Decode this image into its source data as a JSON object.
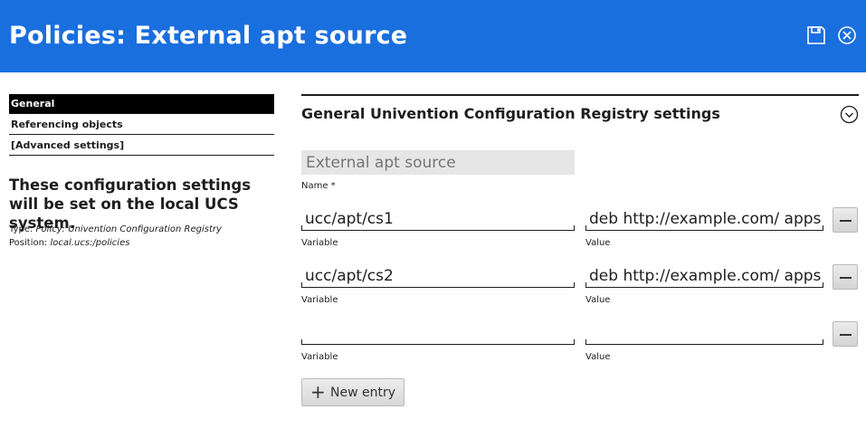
{
  "header": {
    "title": "Policies: External apt source",
    "save_icon": "save-icon",
    "close_icon": "close-icon",
    "background": "#1a6fde"
  },
  "sidebar": {
    "items": [
      {
        "label": "General",
        "active": true
      },
      {
        "label": "Referencing objects",
        "active": false
      },
      {
        "label": "[Advanced settings]",
        "active": false
      }
    ],
    "description": "These configuration settings will be set on the local UCS system.",
    "type_label": "Type:",
    "type_value": "Policy: Univention Configuration Registry",
    "position_label": "Position:",
    "position_value": "local.ucs:/policies"
  },
  "main": {
    "section_title": "General Univention Configuration Registry settings",
    "collapse_icon": "chevron-down-icon",
    "name_field": {
      "value": "",
      "placeholder": "External apt source",
      "label": "Name *"
    },
    "variable_label": "Variable",
    "value_label": "Value",
    "entries": [
      {
        "variable": "ucc/apt/cs1",
        "value": "deb http://example.com/ apps main"
      },
      {
        "variable": "ucc/apt/cs2",
        "value": "deb http://example.com/ apps main"
      },
      {
        "variable": "",
        "value": ""
      }
    ],
    "new_entry_label": "New entry"
  }
}
